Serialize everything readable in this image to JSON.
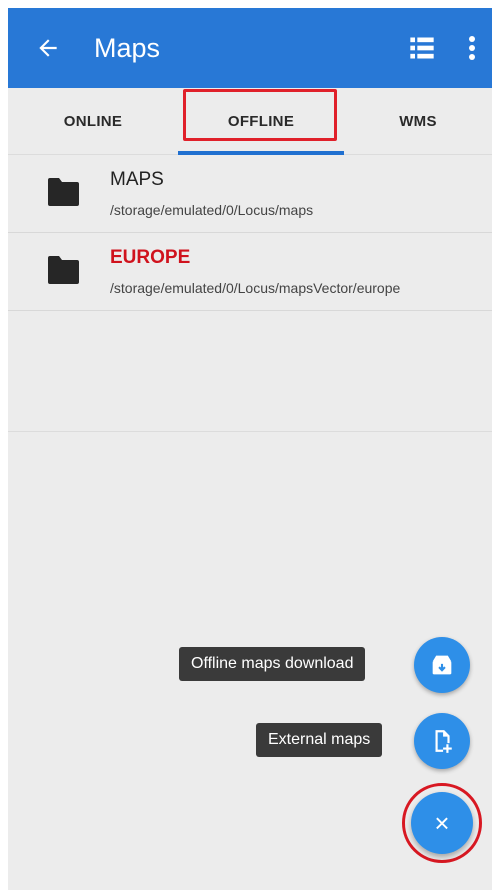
{
  "appbar": {
    "title": "Maps",
    "back_icon": "arrow-left-icon",
    "list_icon": "list-view-icon",
    "overflow_icon": "more-vert-icon",
    "color": "#2878d6"
  },
  "tabs": [
    {
      "label": "ONLINE",
      "selected": false
    },
    {
      "label": "OFFLINE",
      "selected": true
    },
    {
      "label": "WMS",
      "selected": false
    }
  ],
  "folders": [
    {
      "name": "MAPS",
      "path": "/storage/emulated/0/Locus/maps",
      "highlight": false
    },
    {
      "name": "EUROPE",
      "path": "/storage/emulated/0/Locus/mapsVector/europe",
      "highlight": true
    }
  ],
  "fab_menu": {
    "items": [
      {
        "label": "Offline maps download",
        "icon": "store-download-icon"
      },
      {
        "label": "External maps",
        "icon": "add-file-icon"
      }
    ],
    "close_label": "×",
    "accent": "#2e8fe8",
    "highlight_color": "#d81822"
  }
}
